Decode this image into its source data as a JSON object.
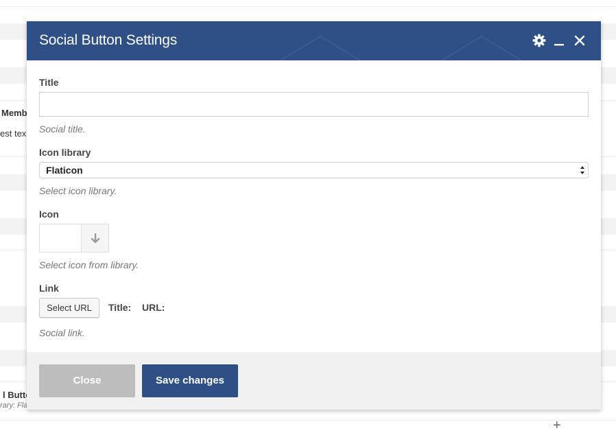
{
  "background": {
    "row1_text": "Memb",
    "row2_text": "est tex",
    "row3_text": "l Butto",
    "row4_text": "rary: Fla",
    "plus_glyph": "+"
  },
  "modal": {
    "title": "Social Button Settings",
    "header_color": "#2f4f87",
    "icons": {
      "settings": "gear-icon",
      "minimize": "minimize-icon",
      "close": "close-icon"
    }
  },
  "form": {
    "title_field": {
      "label": "Title",
      "value": "",
      "placeholder": "",
      "help": "Social title."
    },
    "icon_library": {
      "label": "Icon library",
      "selected": "Flaticon",
      "help": "Select icon library."
    },
    "icon": {
      "label": "Icon",
      "help": "Select icon from library."
    },
    "link": {
      "label": "Link",
      "button": "Select URL",
      "title_label": "Title:",
      "url_label": "URL:",
      "help": "Social link."
    }
  },
  "footer": {
    "close_label": "Close",
    "save_label": "Save changes"
  }
}
